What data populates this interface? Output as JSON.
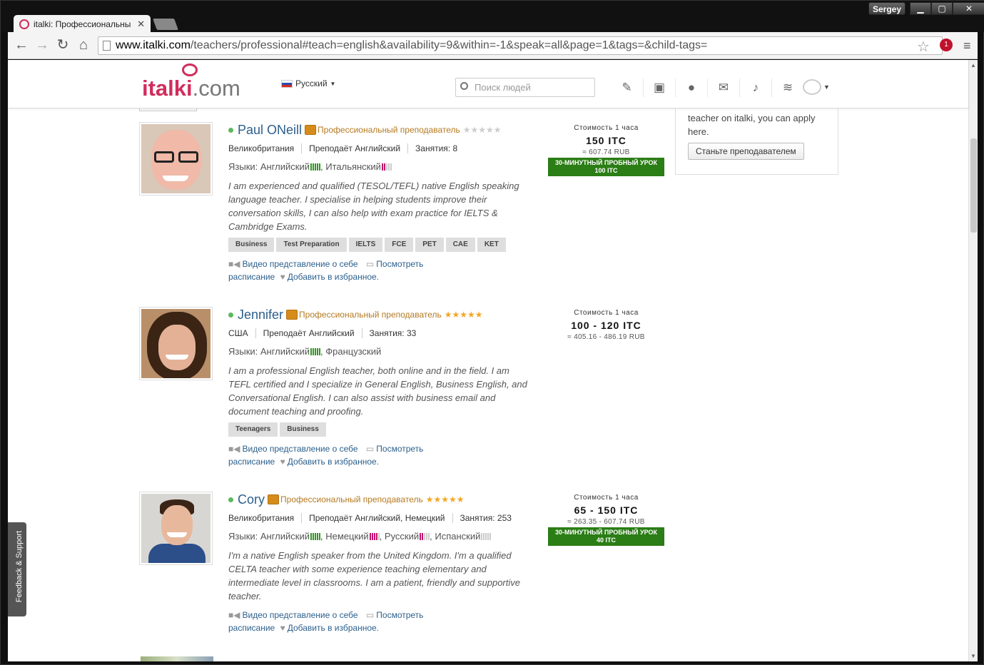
{
  "browser": {
    "tab_title": "italki: Профессиональны",
    "tab_close": "✕",
    "user_name": "Sergey",
    "url_host": "www.italki.com",
    "url_path": "/teachers/professional#teach=english&availability=9&within=-1&speak=all&page=1&tags=&child-tags=",
    "extension_count": "1"
  },
  "header": {
    "logo_main": "italki",
    "logo_tld": ".com",
    "language": "Русский",
    "search_placeholder": "Поиск людей"
  },
  "sidebar": {
    "text": "teacher on italki, you can apply here.",
    "button": "Станьте преподавателем"
  },
  "feedback": "Feedback & Support",
  "pro_label": "Профессиональный преподаватель",
  "price_label": "Стоимость 1 часа",
  "actions": {
    "video": "Видео представление о себе",
    "schedule": "Посмотреть расписание",
    "favorite": "Добавить в избранное."
  },
  "teachers": [
    {
      "name": "Paul ONeill",
      "rating_stars": 0,
      "country": "Великобритания",
      "teaches": "Преподаёт Английский",
      "lessons": "Занятия: 8",
      "langs_prefix": "Языки: Английский",
      "lang2": ", Итальянский",
      "desc": "I am experienced and qualified (TESOL/TEFL) native English speaking language teacher. I specialise in helping students improve their conversation skills, I can also help with exam practice for IELTS & Cambridge Exams.",
      "tags": [
        "Business",
        "Test Preparation",
        "IELTS",
        "FCE",
        "PET",
        "CAE",
        "KET"
      ],
      "price": "150 ITC",
      "price_rub": "≈ 607.74 RUB",
      "trial_line1": "30-МИНУТНЫЙ ПРОБНЫЙ УРОК",
      "trial_line2": "100 ITC"
    },
    {
      "name": "Jennifer",
      "rating_stars": 5,
      "country": "США",
      "teaches": "Преподаёт Английский",
      "lessons": "Занятия: 33",
      "langs_prefix": "Языки: Английский",
      "lang2": ", Французский",
      "desc": "I am a professional English teacher, both online and in the field. I am TEFL certified and I specialize in General English, Business English, and Conversational English. I can also assist with business email and document teaching and proofing.",
      "tags": [
        "Teenagers",
        "Business"
      ],
      "price": "100 - 120 ITC",
      "price_rub": "≈ 405.16 - 486.19 RUB"
    },
    {
      "name": "Cory",
      "rating_stars": 5,
      "country": "Великобритания",
      "teaches": "Преподаёт Английский, Немецкий",
      "lessons": "Занятия: 253",
      "langs_prefix": "Языки: Английский",
      "lang2": ", Немецкий",
      "lang3": ", Русский",
      "lang4": ", Испанский",
      "desc": "I'm a native English speaker from the United Kingdom. I'm a qualified CELTA teacher with some experience teaching elementary and intermediate level in classrooms. I am a patient, friendly and supportive teacher.",
      "price": "65 - 150 ITC",
      "price_rub": "≈ 263.35 - 607.74 RUB",
      "trial_line1": "30-МИНУТНЫЙ ПРОБНЫЙ УРОК",
      "trial_line2": "40 ITC"
    }
  ],
  "colors": {
    "brand": "#d22c5c",
    "link": "#2b5f8c",
    "trial_green": "#2b7d15",
    "star": "#f5a623"
  }
}
